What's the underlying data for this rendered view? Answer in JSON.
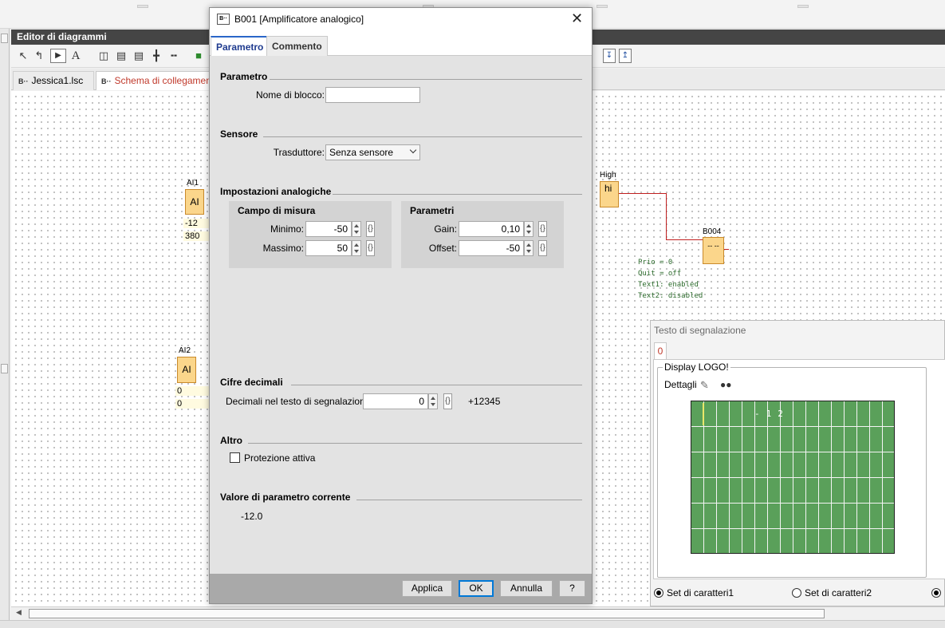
{
  "editor": {
    "title": "Editor di diagrammi",
    "file_tabs": [
      {
        "icon": "B··",
        "label": "Jessica1.lsc"
      },
      {
        "icon": "B··",
        "label": "Schema di collegamento"
      }
    ],
    "text_tool": "A",
    "blocks": {
      "ai1": {
        "name": "AI1",
        "type": "AI",
        "values": [
          "-12",
          "380"
        ]
      },
      "ai2": {
        "name": "AI2",
        "type": "AI",
        "values": [
          "0",
          "0"
        ]
      },
      "high": {
        "name": "High",
        "type": "hi"
      },
      "b004": {
        "name": "B004",
        "type": "-- --"
      }
    },
    "b004_notes": [
      "Prio = 0",
      "Quit = off",
      "Text1: enabled",
      "Text2: disabled"
    ]
  },
  "message_panel": {
    "title": "Testo di segnalazione",
    "tab": "0",
    "group_label": "Display LOGO!",
    "details_label": "Dettagli",
    "lcd_text": "-12",
    "lcd_cols": 16,
    "lcd_rows": 6,
    "charset1": "Set di caratteri1",
    "charset2": "Set di caratteri2",
    "charset_selected": 1
  },
  "dialog": {
    "icon": "B··",
    "title": "B001 [Amplificatore analogico]",
    "close_glyph": "✕",
    "tabs": {
      "parametro": "Parametro",
      "commento": "Commento"
    },
    "sections": {
      "parametro": "Parametro",
      "sensore": "Sensore",
      "impostazioni": "Impostazioni analogiche",
      "cifre": "Cifre decimali",
      "altro": "Altro",
      "valore": "Valore di parametro corrente"
    },
    "block_name_label": "Nome di blocco:",
    "block_name_value": "",
    "sensor_label": "Trasduttore:",
    "sensor_value": "Senza sensore",
    "range_group": "Campo di misura",
    "min_label": "Minimo:",
    "min_value": "-50",
    "max_label": "Massimo:",
    "max_value": "50",
    "params_group": "Parametri",
    "gain_label": "Gain:",
    "gain_value": "0,10",
    "offset_label": "Offset:",
    "offset_value": "-50",
    "decimals_label": "Decimali nel testo di segnalazione:",
    "decimals_value": "0",
    "decimals_preview": "+12345",
    "protection_label": "Protezione attiva",
    "protection_checked": false,
    "current_value": "-12.0",
    "brace_glyph": "{}",
    "buttons": {
      "apply": "Applica",
      "ok": "OK",
      "cancel": "Annulla",
      "help": "?"
    }
  }
}
